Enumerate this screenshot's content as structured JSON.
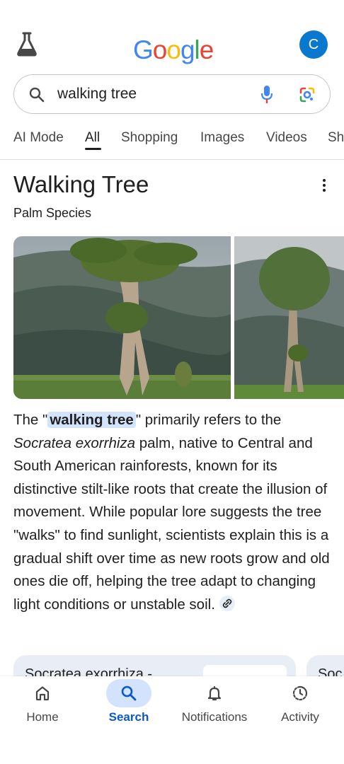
{
  "header": {
    "logo_letters": [
      "G",
      "o",
      "o",
      "g",
      "l",
      "e"
    ],
    "logo_colors": [
      "#4285f4",
      "#ea4335",
      "#fbbc05",
      "#4285f4",
      "#34a853",
      "#ea4335"
    ],
    "avatar_initial": "C",
    "avatar_color": "#0b78d0",
    "labs_icon": "flask-icon"
  },
  "search": {
    "query": "walking tree",
    "left_icon": "search-icon",
    "voice_icon": "mic-icon",
    "lens_icon": "lens-icon"
  },
  "tabs": [
    {
      "label": "AI Mode",
      "active": false
    },
    {
      "label": "All",
      "active": true
    },
    {
      "label": "Shopping",
      "active": false
    },
    {
      "label": "Images",
      "active": false
    },
    {
      "label": "Videos",
      "active": false
    },
    {
      "label": "Sh",
      "active": false
    }
  ],
  "knowledge_panel": {
    "title": "Walking Tree",
    "subtitle": "Palm Species",
    "more_icon": "more-vert-icon"
  },
  "overview": {
    "p1": "The \"",
    "highlight": "walking tree",
    "p2": "\" primarily refers to the ",
    "italic": "Socratea exorrhiza",
    "p3": " palm, native to Central and South American rainforests, known for its distinctive stilt-like roots that create the illusion of movement. While popular lore suggests the tree \"walks\" to find sunlight, scientists explain this is a gradual shift over time as new roots grow and old ones die off, helping the tree adapt to changing light conditions or unstable soil.",
    "link_icon": "link-icon"
  },
  "source_cards": [
    {
      "title": "Socratea exorrhiza -"
    },
    {
      "title": "Soc"
    }
  ],
  "bottom_nav": [
    {
      "label": "Home",
      "icon": "home-icon",
      "active": false
    },
    {
      "label": "Search",
      "icon": "search-icon",
      "active": true
    },
    {
      "label": "Notifications",
      "icon": "bell-icon",
      "active": false
    },
    {
      "label": "Activity",
      "icon": "activity-icon",
      "active": false
    }
  ],
  "colors": {
    "accent": "#0b57d0",
    "highlight_bg": "#d3e3fd",
    "card_bg": "#e9eef6"
  }
}
